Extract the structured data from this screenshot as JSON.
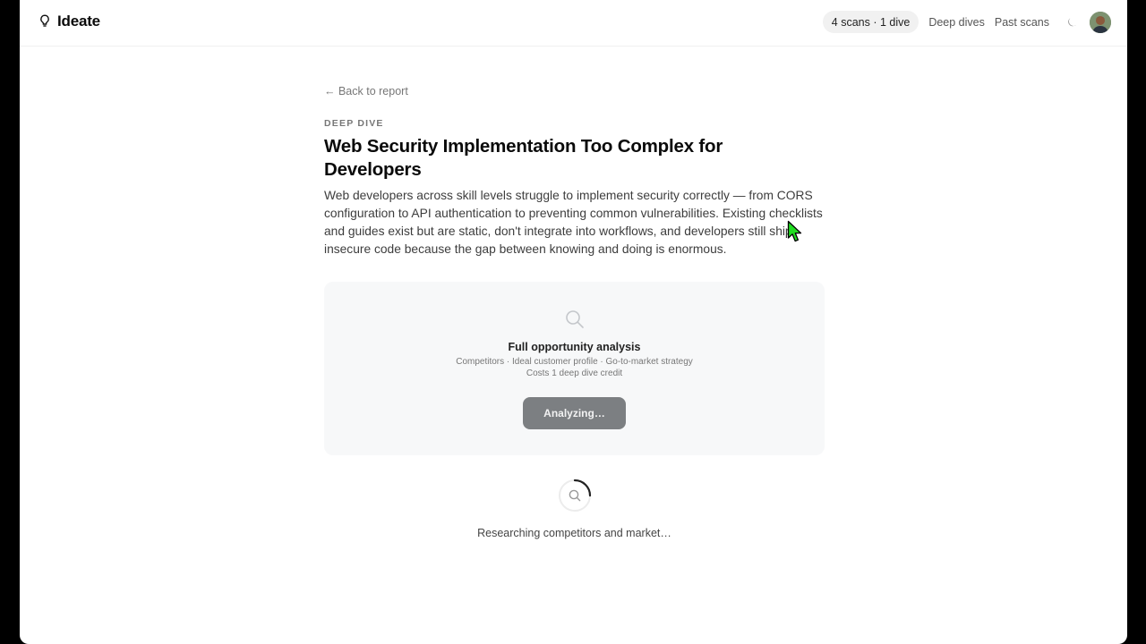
{
  "header": {
    "brand": "Ideate",
    "usage": "4 scans · 1 dive",
    "nav": [
      "Deep dives",
      "Past scans"
    ]
  },
  "page": {
    "back_label": "← Back to report",
    "eyebrow": "DEEP DIVE",
    "title": "Web Security Implementation Too Complex for Developers",
    "description": "Web developers across skill levels struggle to implement security correctly — from CORS configuration to API authentication to preventing common vulnerabilities. Existing checklists and guides exist but are static, don't integrate into workflows, and developers still ship insecure code because the gap between knowing and doing is enormous."
  },
  "analysis_card": {
    "icon": "search-icon",
    "title": "Full opportunity analysis",
    "subtitle": "Competitors · Ideal customer profile · Go-to-market strategy",
    "cost": "Costs 1 deep dive credit",
    "button_label": "Analyzing…"
  },
  "progress": {
    "icon": "search-icon",
    "status": "Researching competitors and market…"
  },
  "colors": {
    "button_bg": "#7c7f82",
    "card_bg": "#f7f8f9",
    "cursor": "#22dd22"
  }
}
